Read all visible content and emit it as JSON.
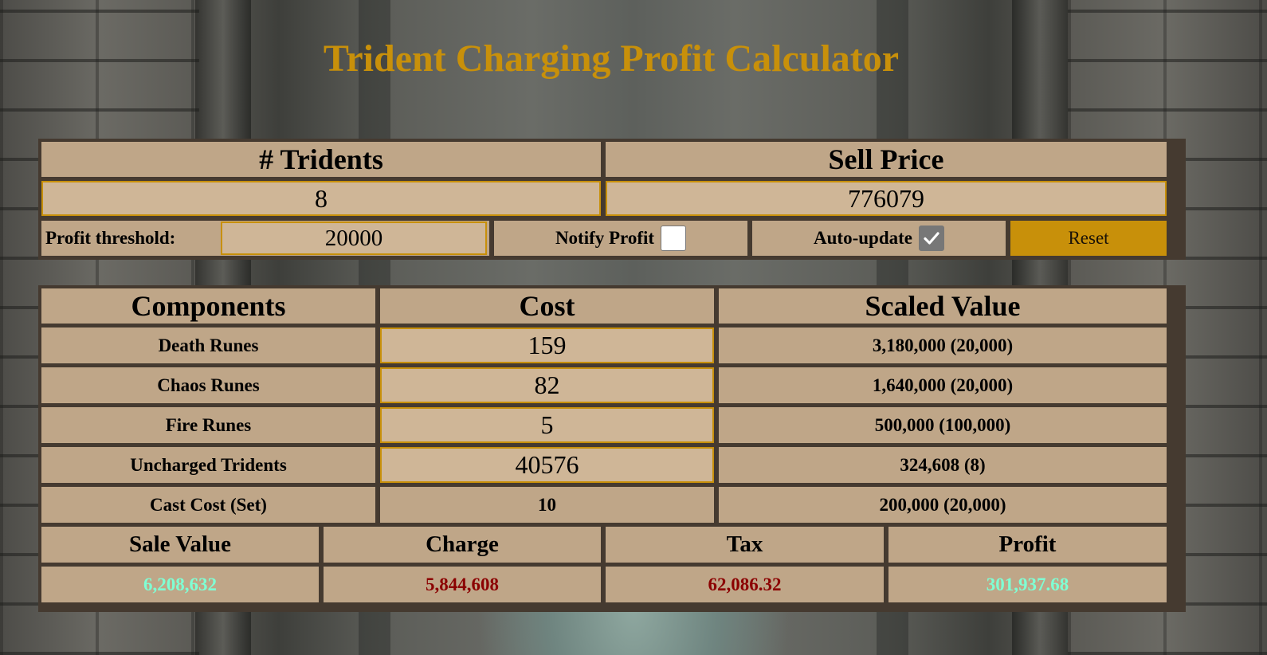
{
  "title": "Trident Charging Profit Calculator",
  "top": {
    "tridents_header": "# Tridents",
    "sell_price_header": "Sell Price",
    "tridents_value": "8",
    "sell_price_value": "776079",
    "profit_threshold_label": "Profit threshold:",
    "profit_threshold_value": "20000",
    "notify_profit_label": "Notify Profit",
    "notify_profit_checked": false,
    "auto_update_label": "Auto-update",
    "auto_update_checked": true,
    "reset_label": "Reset"
  },
  "table": {
    "headers": [
      "Components",
      "Cost",
      "Scaled Value"
    ],
    "rows": [
      {
        "component": "Death Runes",
        "cost": "159",
        "scaled": "3,180,000 (20,000)",
        "editable": true
      },
      {
        "component": "Chaos Runes",
        "cost": "82",
        "scaled": "1,640,000 (20,000)",
        "editable": true
      },
      {
        "component": "Fire Runes",
        "cost": "5",
        "scaled": "500,000 (100,000)",
        "editable": true
      },
      {
        "component": "Uncharged Tridents",
        "cost": "40576",
        "scaled": "324,608 (8)",
        "editable": true
      },
      {
        "component": "Cast Cost (Set)",
        "cost": "10",
        "scaled": "200,000 (20,000)",
        "editable": false
      }
    ]
  },
  "summary": {
    "headers": [
      "Sale Value",
      "Charge",
      "Tax",
      "Profit"
    ],
    "values": [
      "6,208,632",
      "5,844,608",
      "62,086.32",
      "301,937.68"
    ]
  },
  "colors": {
    "accent": "#c8900a",
    "positive": "#7fffd4",
    "negative": "#8b0000",
    "cell": "#bfa688",
    "input": "#cfb697",
    "border": "#453a30"
  }
}
